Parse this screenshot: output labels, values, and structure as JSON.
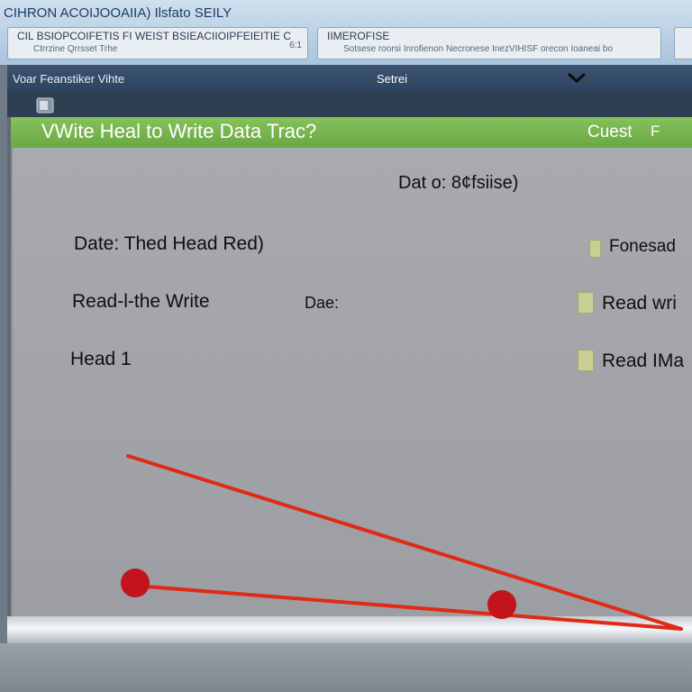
{
  "window": {
    "title": "CIHRON ACOIJOOAIIA) Ilsfato SEILY",
    "tabs": [
      {
        "line1": "CIL BSIOPCOIFETIS FI WEIST BSIEACIIOIPFEIEITIE C",
        "line2": "Ctrrzine Qrrsset Trhe",
        "number": "6:1"
      },
      {
        "line1": "IIMEROFISE",
        "line2": "Sotsese roorsi Inrofienon Necronese InezVIHISF orecon Ioaneai bo",
        "number": ""
      }
    ]
  },
  "header": {
    "left_label": "Voar Feanstiker Vihte",
    "select_value": "Setrei",
    "chevron_icon": "chevron-down-icon"
  },
  "titlebar": {
    "title": "VWite Heal to Write Data Trac?",
    "right_label": "Cuest",
    "right_letter": "F",
    "color": "#74b04c"
  },
  "content": {
    "header": "Dat o: 8¢fsiise)",
    "rows": [
      {
        "label": "Date: Thed Head Red)",
        "middle": "",
        "right": "Fonesad",
        "checked": false
      },
      {
        "label": "Read-l-the Write",
        "middle": "Dae:",
        "right": "Read wri",
        "checked": false
      },
      {
        "label": "Head 1",
        "middle": "",
        "right": "Read IMa",
        "checked": false
      }
    ]
  },
  "annotation": {
    "color": "#e02a18",
    "marker_color": "#c2141a"
  }
}
